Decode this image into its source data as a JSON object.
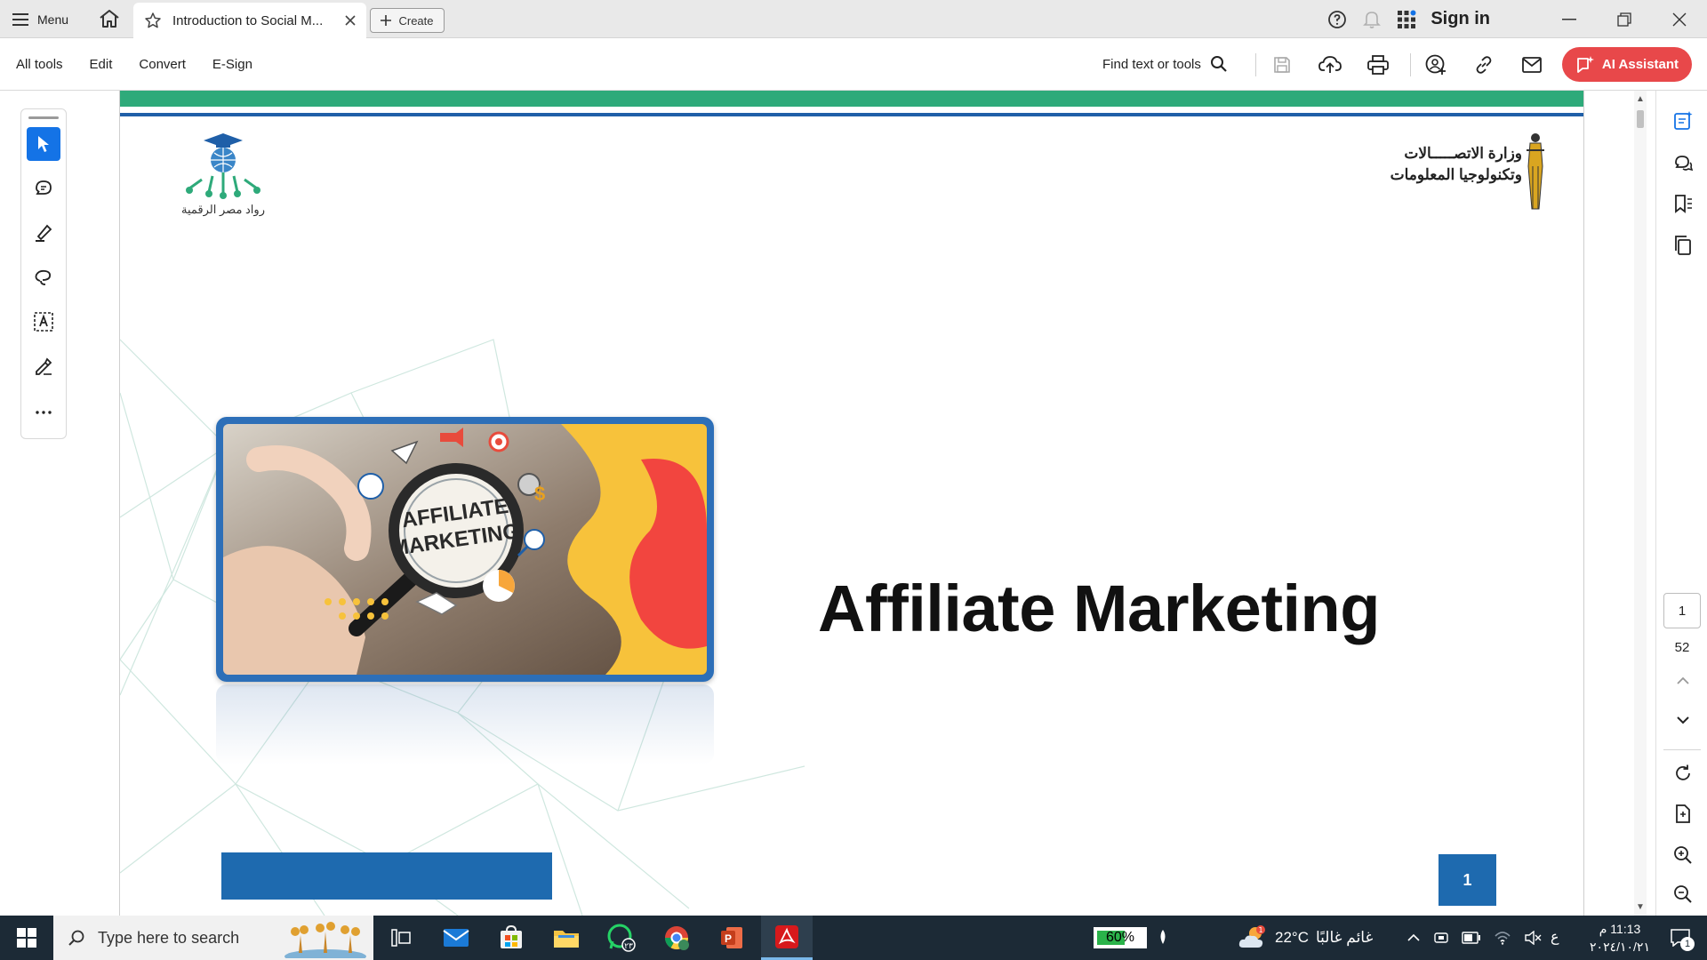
{
  "tabbar": {
    "menu_label": "Menu",
    "tab_title": "Introduction to Social M...",
    "create_label": "Create",
    "signin_label": "Sign in"
  },
  "toolbar": {
    "menus": [
      "All tools",
      "Edit",
      "Convert",
      "E-Sign"
    ],
    "find_label": "Find text or tools",
    "ai_label": "AI Assistant"
  },
  "document": {
    "left_logo_caption": "رواد مصر الرقمية",
    "ministry_line1": "وزارة الاتصـــــالات",
    "ministry_line2": "وتكنولوجيا المعلومات",
    "photo_text_line1": "AFFILIATE",
    "photo_text_line2": "MARKETING",
    "title": "Affiliate Marketing",
    "page_label": "1"
  },
  "navigation": {
    "current_page": "1",
    "total_pages": "52"
  },
  "taskbar": {
    "search_placeholder": "Type here to search",
    "battery": "60%",
    "battery_level": 0.6,
    "weather_temp": "22°C",
    "weather_desc": "غائم غالبًا",
    "input_lang": "ع",
    "time": "11:13 م",
    "date": "٢٠٢٤/١٠/٢١",
    "notification_count": "1"
  },
  "colors": {
    "accent_blue": "#1473e6",
    "ai_button": "#e8484a",
    "page_green_stripe": "#2eaa7a",
    "page_blue": "#1e6aaf",
    "taskbar": "#1c2a36"
  },
  "icons": {
    "tabbar": [
      "hamburger-icon",
      "home-icon",
      "star-icon",
      "close-icon",
      "plus-icon",
      "help-icon",
      "bell-icon",
      "apps-grid-icon",
      "minimize-icon",
      "restore-icon",
      "close-window-icon"
    ],
    "toolbar": [
      "search-icon",
      "save-icon",
      "upload-icon",
      "print-icon",
      "share-user-icon",
      "link-icon",
      "mail-icon",
      "ai-sparkle-icon"
    ],
    "left_tools": [
      "select-arrow-icon",
      "comment-icon",
      "highlight-pen-icon",
      "lasso-draw-icon",
      "text-box-icon",
      "fill-sign-icon",
      "more-tools-icon"
    ],
    "right_panel": [
      "ai-panel-icon",
      "comments-panel-icon",
      "bookmark-icon",
      "copy-pages-icon",
      "scroll-up-icon",
      "scroll-down-icon",
      "refresh-icon",
      "export-file-icon",
      "zoom-in-icon",
      "zoom-out-icon"
    ]
  }
}
